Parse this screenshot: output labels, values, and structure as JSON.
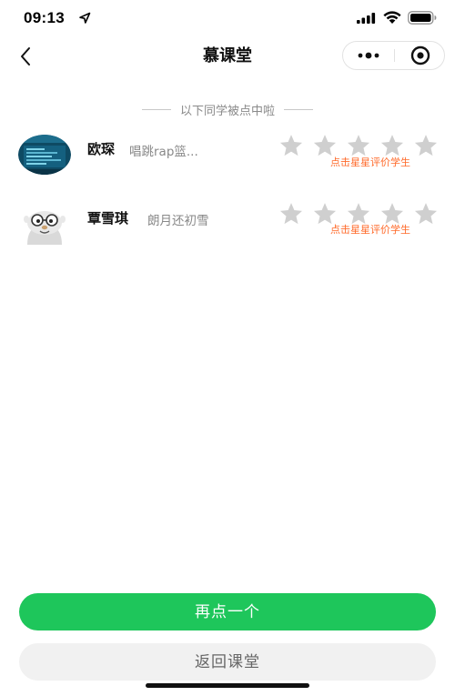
{
  "status_bar": {
    "time": "09:13"
  },
  "nav": {
    "title": "慕课堂",
    "back_icon": "chevron-left-icon",
    "menu_icon": "more-dots-icon",
    "close_icon": "target-close-icon"
  },
  "section": {
    "header": "以下同学被点中啦"
  },
  "students": [
    {
      "name": "欧琛",
      "motto": "唱跳rap篮...",
      "rating": 0,
      "max_rating": 5,
      "rate_hint": "点击星星评价学生",
      "avatar": "screenshot-avatar"
    },
    {
      "name": "覃雪琪",
      "motto": "朗月还初雪",
      "rating": 0,
      "max_rating": 5,
      "rate_hint": "点击星星评价学生",
      "avatar": "cartoon-character-avatar"
    }
  ],
  "actions": {
    "primary": "再点一个",
    "secondary": "返回课堂"
  },
  "colors": {
    "primary_green": "#1ec65b",
    "hint_orange": "#ff6a2a",
    "star_empty": "#cfcfcf"
  }
}
